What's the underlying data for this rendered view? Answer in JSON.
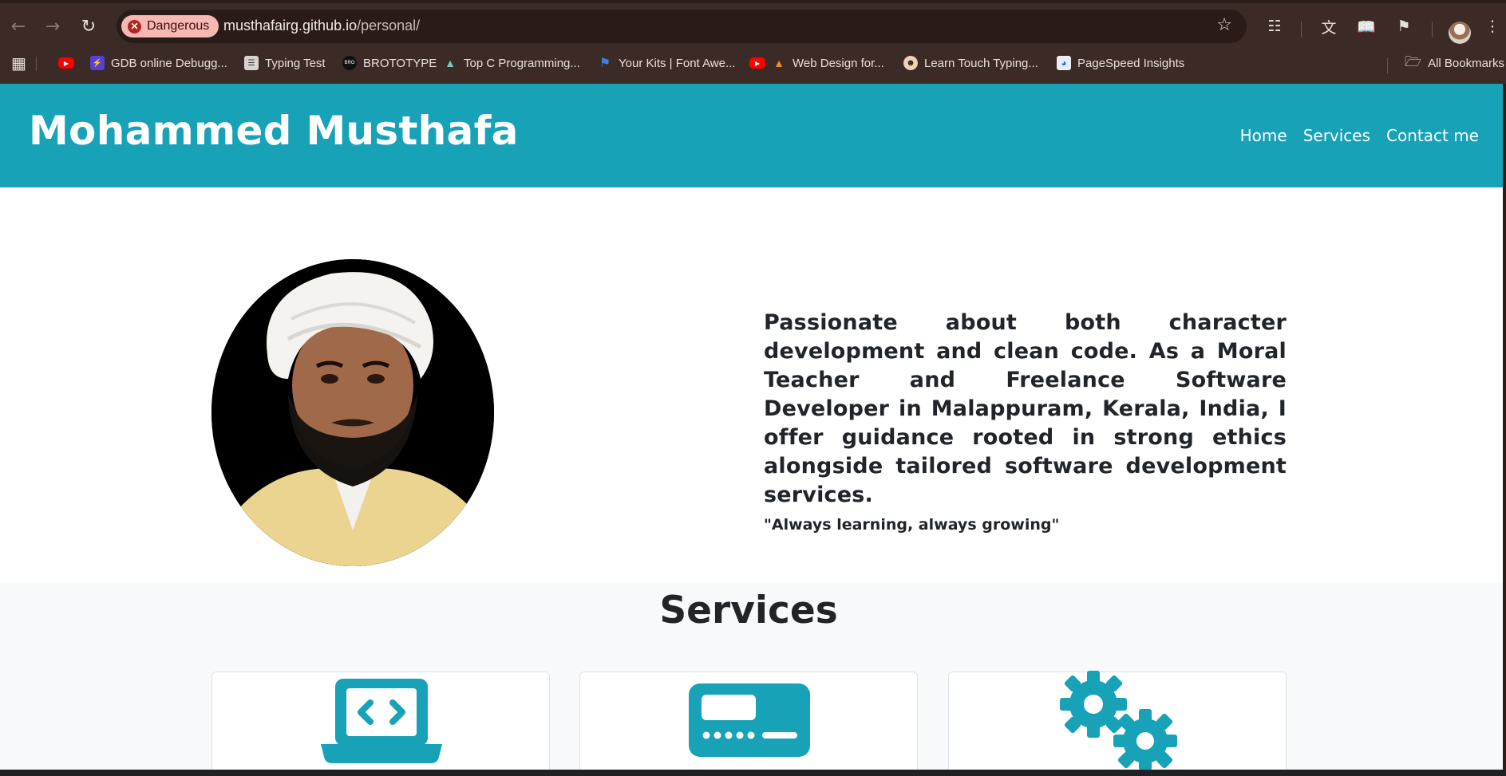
{
  "browser": {
    "security_chip": "Dangerous",
    "url_host": "musthafairg.github.io",
    "url_path": "/personal/",
    "bookmarks": [
      {
        "label": "GDB online Debugg...",
        "icon": "gdb-icon"
      },
      {
        "label": "Typing Test",
        "icon": "document-icon"
      },
      {
        "label": "BROTOTYPE",
        "icon": "brototype-icon"
      },
      {
        "label": "Top C Programming...",
        "icon": "mountain-icon"
      },
      {
        "label": "Your Kits | Font Awe...",
        "icon": "flag-icon"
      },
      {
        "label": "Web Design for...",
        "icon": "fire-icon"
      },
      {
        "label": "Learn Touch Typing...",
        "icon": "face-icon"
      },
      {
        "label": "PageSpeed Insights",
        "icon": "pagespeed-icon"
      }
    ],
    "all_bookmarks": "All Bookmarks"
  },
  "site": {
    "brand": "Mohammed Musthafa",
    "nav": [
      "Home",
      "Services",
      "Contact me"
    ]
  },
  "hero": {
    "description": "Passionate about both character development and clean code. As a Moral Teacher and Freelance Software Developer in Malappuram, Kerala, India, I offer guidance rooted in strong ethics alongside tailored software development services.",
    "quote": "\"Always learning, always growing\""
  },
  "services": {
    "title": "Services",
    "cards": [
      {
        "icon": "laptop-code-icon"
      },
      {
        "icon": "card-icon"
      },
      {
        "icon": "gears-icon"
      }
    ]
  },
  "colors": {
    "brand_teal": "#17a2b8",
    "danger_chip": "#f6b8b1"
  }
}
